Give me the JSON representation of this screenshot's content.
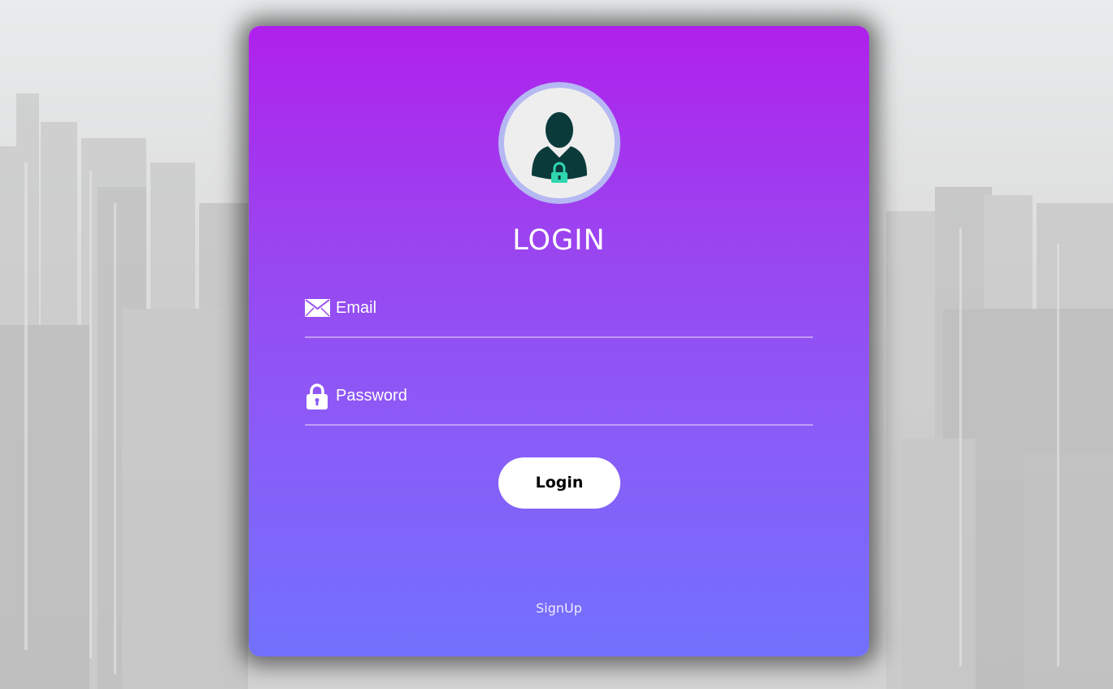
{
  "form": {
    "title": "LOGIN",
    "email": {
      "placeholder": "Email",
      "value": "",
      "icon": "envelope-icon"
    },
    "password": {
      "placeholder": "Password",
      "value": "",
      "icon": "lock-icon"
    },
    "login_button": "Login",
    "signup_link": "SignUp",
    "avatar_icon": "user-lock-icon"
  },
  "colors": {
    "card_gradient_top": "#b020ec",
    "card_gradient_bottom": "#7271fd",
    "avatar_ring": "#b5b8f2",
    "avatar_figure": "#0b3a3a",
    "lock_badge": "#2fd6b0",
    "button_bg": "#ffffff"
  }
}
